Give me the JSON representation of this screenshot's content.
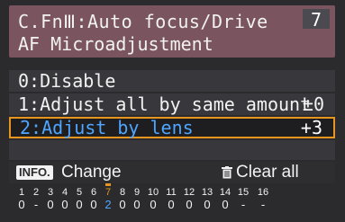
{
  "header": {
    "title_line1": "C.FnⅢ:Auto focus/Drive",
    "page_number": "7",
    "title_line2": "AF Microadjustment"
  },
  "options": [
    {
      "label": "0:Disable",
      "value": ""
    },
    {
      "label": "1:Adjust all by same amount",
      "value": "±0"
    },
    {
      "label": "2:Adjust by lens",
      "value": "+3"
    }
  ],
  "selected_option_index": 2,
  "footer": {
    "info_badge": "INFO.",
    "change_label": "Change",
    "clear_label": "Clear all"
  },
  "function_strip": {
    "numbers": [
      "1",
      "2",
      "3",
      "4",
      "5",
      "6",
      "7",
      "8",
      "9",
      "10",
      "11",
      "12",
      "13",
      "14",
      "15",
      "16"
    ],
    "values": [
      "0",
      "-",
      "0",
      "0",
      "0",
      "0",
      "2",
      "0",
      "0",
      "0",
      "0",
      "0",
      "0",
      "0",
      "-",
      "-"
    ],
    "active_index": 6
  },
  "colors": {
    "header_bg": "#7a5560",
    "highlight_border": "#e6951e",
    "selected_text": "#4ea6ff"
  }
}
